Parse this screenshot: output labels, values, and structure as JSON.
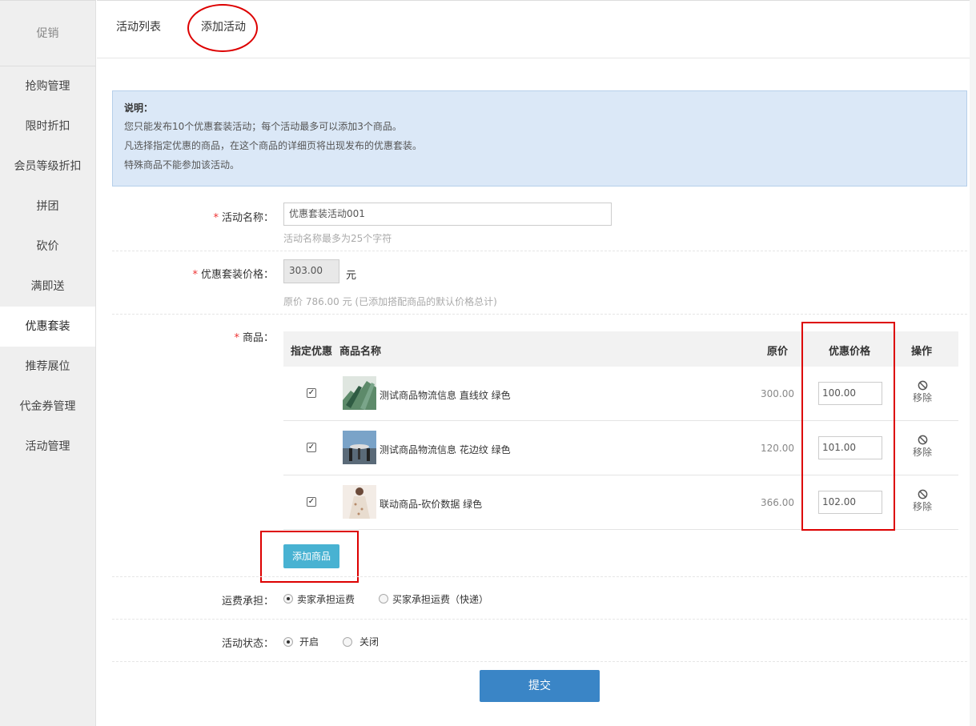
{
  "sidebar": {
    "title": "促销",
    "items": [
      {
        "label": "抢购管理"
      },
      {
        "label": "限时折扣"
      },
      {
        "label": "会员等级折扣"
      },
      {
        "label": "拼团"
      },
      {
        "label": "砍价"
      },
      {
        "label": "满即送"
      },
      {
        "label": "优惠套装",
        "active": true
      },
      {
        "label": "推荐展位"
      },
      {
        "label": "代金券管理"
      },
      {
        "label": "活动管理"
      }
    ]
  },
  "tabs": [
    {
      "label": "活动列表"
    },
    {
      "label": "添加活动"
    }
  ],
  "notice": {
    "title": "说明：",
    "lines": [
      "您只能发布10个优惠套装活动；每个活动最多可以添加3个商品。",
      "凡选择指定优惠的商品，在这个商品的详细页将出现发布的优惠套装。",
      "特殊商品不能参加该活动。"
    ]
  },
  "form": {
    "name": {
      "required": "*",
      "label": "活动名称：",
      "value": "优惠套装活动001",
      "hint": "活动名称最多为25个字符"
    },
    "price": {
      "required": "*",
      "label": "优惠套装价格：",
      "value": "303.00",
      "unit": "元",
      "hint": "原价 786.00 元 (已添加搭配商品的默认价格总计)"
    },
    "goods": {
      "required": "*",
      "label": "商品：",
      "headers": {
        "select": "指定优惠",
        "name": "商品名称",
        "price": "原价",
        "discount": "优惠价格",
        "action": "操作"
      },
      "rows": [
        {
          "checked": "✓",
          "name": "测试商品物流信息 直线纹 绿色",
          "price": "300.00",
          "discount": "100.00",
          "action": "移除"
        },
        {
          "checked": "✓",
          "name": "测试商品物流信息 花边纹 绿色",
          "price": "120.00",
          "discount": "101.00",
          "action": "移除"
        },
        {
          "checked": "✓",
          "name": "联动商品-砍价数据 绿色",
          "price": "366.00",
          "discount": "102.00",
          "action": "移除"
        }
      ],
      "add_button": "添加商品"
    },
    "shipping": {
      "label": "运费承担：",
      "options": [
        "卖家承担运费",
        "买家承担运费（快递）"
      ],
      "selected": 0
    },
    "status": {
      "label": "活动状态：",
      "options": [
        "开启",
        "关闭"
      ],
      "selected": 0
    },
    "submit": "提交"
  }
}
